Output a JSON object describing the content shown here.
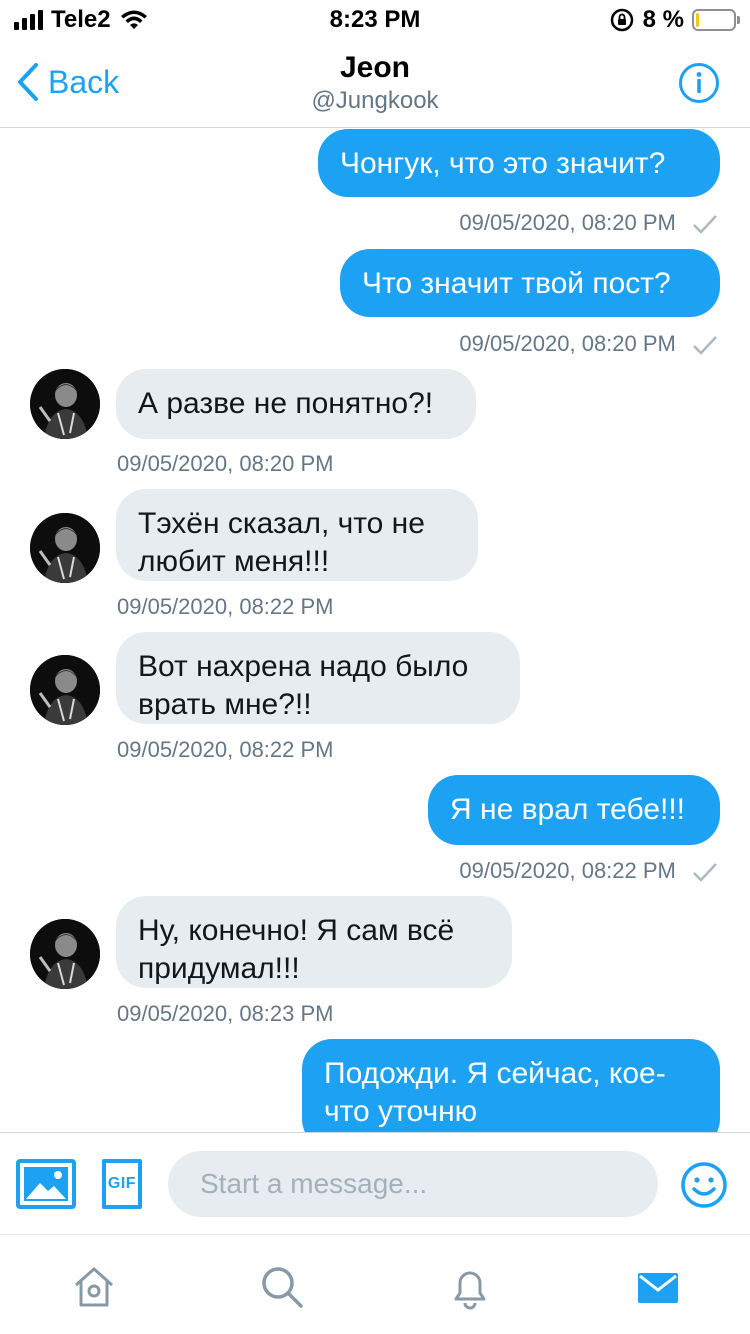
{
  "status_bar": {
    "carrier": "Tele2",
    "time": "8:23 PM",
    "battery_percent": "8 %",
    "battery_level": 0.08,
    "battery_color": "#f5c518"
  },
  "header": {
    "back_label": "Back",
    "name": "Jeon",
    "handle": "@Jungkook",
    "back_icon": "chevron-left-icon",
    "info_icon": "info-icon"
  },
  "messages": [
    {
      "dir": "out",
      "text": "Чонгук, что это значит?",
      "time": "09/05/2020, 08:20 PM"
    },
    {
      "dir": "out",
      "text": "Что значит твой пост?",
      "time": "09/05/2020, 08:20 PM"
    },
    {
      "dir": "in",
      "text": "А разве не понятно?!",
      "time": "09/05/2020, 08:20 PM"
    },
    {
      "dir": "in",
      "text": "Тэхён сказал, что не любит меня!!!",
      "time": "09/05/2020, 08:22 PM"
    },
    {
      "dir": "in",
      "text": "Вот нахрена надо было врать мне?!!",
      "time": "09/05/2020, 08:22 PM"
    },
    {
      "dir": "out",
      "text": "Я не врал тебе!!!",
      "time": "09/05/2020, 08:22 PM"
    },
    {
      "dir": "in",
      "text": "Ну, конечно! Я сам всё придумал!!!",
      "time": "09/05/2020, 08:23 PM"
    },
    {
      "dir": "out",
      "text": "Подожди. Я сейчас, кое-что уточню",
      "time": ""
    }
  ],
  "composer": {
    "placeholder": "Start a message...",
    "gif_label": "GIF",
    "image_icon": "image-icon",
    "emoji_icon": "emoji-icon"
  },
  "tabbar": {
    "items": [
      "home-icon",
      "search-icon",
      "notifications-icon",
      "messages-icon"
    ],
    "active": "messages-icon"
  },
  "colors": {
    "accent": "#1da1f2",
    "incoming_bubble": "#e6ecf0",
    "secondary_text": "#657786"
  }
}
